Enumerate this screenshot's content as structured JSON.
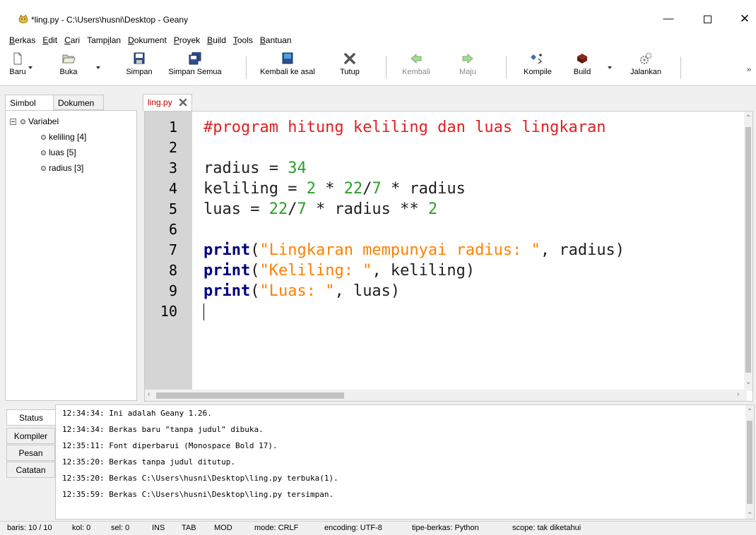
{
  "window": {
    "title": "*ling.py - C:\\Users\\husni\\Desktop - Geany",
    "min_glyph": "—",
    "close_glyph": "✕"
  },
  "menubar": {
    "items": [
      {
        "label": "Berkas",
        "mnemonic_index": 0
      },
      {
        "label": "Edit",
        "mnemonic_index": 0
      },
      {
        "label": "Cari",
        "mnemonic_index": 0
      },
      {
        "label": "Tampilan",
        "mnemonic_index": 4
      },
      {
        "label": "Dokument",
        "mnemonic_index": 0
      },
      {
        "label": "Proyek",
        "mnemonic_index": 0
      },
      {
        "label": "Build",
        "mnemonic_index": 0
      },
      {
        "label": "Tools",
        "mnemonic_index": 0
      },
      {
        "label": "Bantuan",
        "mnemonic_index": 0
      }
    ]
  },
  "toolbar": {
    "baru": "Baru",
    "buka": "Buka",
    "simpan": "Simpan",
    "simpan_semua": "Simpan Semua",
    "kembali_ke_asal": "Kembali ke asal",
    "tutup": "Tutup",
    "kembali": "Kembali",
    "maju": "Maju",
    "kompile": "Kompile",
    "build": "Build",
    "jalankan": "Jalankan",
    "more": "»"
  },
  "sidebar": {
    "tabs": [
      "Simbol",
      "Dokumen"
    ],
    "tree": {
      "root": "Variabel",
      "children": [
        "keliling [4]",
        "luas [5]",
        "radius [3]"
      ]
    }
  },
  "editor": {
    "tab_label": "ling.py",
    "line_numbers": [
      "1",
      "2",
      "3",
      "4",
      "5",
      "6",
      "7",
      "8",
      "9",
      "10"
    ],
    "current_line": 10,
    "lines": [
      [
        {
          "t": "#program hitung keliling dan luas lingkaran",
          "c": "comment"
        }
      ],
      [],
      [
        {
          "t": "radius = ",
          "c": "id"
        },
        {
          "t": "34",
          "c": "num"
        }
      ],
      [
        {
          "t": "keliling = ",
          "c": "id"
        },
        {
          "t": "2",
          "c": "num"
        },
        {
          "t": " * ",
          "c": "id"
        },
        {
          "t": "22",
          "c": "num"
        },
        {
          "t": "/",
          "c": "id"
        },
        {
          "t": "7",
          "c": "num"
        },
        {
          "t": " * radius",
          "c": "id"
        }
      ],
      [
        {
          "t": "luas = ",
          "c": "id"
        },
        {
          "t": "22",
          "c": "num"
        },
        {
          "t": "/",
          "c": "id"
        },
        {
          "t": "7",
          "c": "num"
        },
        {
          "t": " * radius ** ",
          "c": "id"
        },
        {
          "t": "2",
          "c": "num"
        }
      ],
      [],
      [
        {
          "t": "print",
          "c": "kw"
        },
        {
          "t": "(",
          "c": "id"
        },
        {
          "t": "\"Lingkaran mempunyai radius: \"",
          "c": "str"
        },
        {
          "t": ", radius)",
          "c": "id"
        }
      ],
      [
        {
          "t": "print",
          "c": "kw"
        },
        {
          "t": "(",
          "c": "id"
        },
        {
          "t": "\"Keliling: \"",
          "c": "str"
        },
        {
          "t": ", keliling)",
          "c": "id"
        }
      ],
      [
        {
          "t": "print",
          "c": "kw"
        },
        {
          "t": "(",
          "c": "id"
        },
        {
          "t": "\"Luas: \"",
          "c": "str"
        },
        {
          "t": ", luas)",
          "c": "id"
        }
      ],
      []
    ]
  },
  "messages": {
    "tabs": [
      "Status",
      "Kompiler",
      "Pesan",
      "Catatan"
    ],
    "lines": [
      "12:34:34: Ini adalah Geany 1.26.",
      "12:34:34: Berkas baru \"tanpa judul\" dibuka.",
      "12:35:11: Font diperbarui (Monospace Bold 17).",
      "12:35:20: Berkas tanpa judul ditutup.",
      "12:35:20: Berkas C:\\Users\\husni\\Desktop\\ling.py terbuka(1).",
      "12:35:59: Berkas C:\\Users\\husni\\Desktop\\ling.py tersimpan."
    ]
  },
  "statusbar": {
    "line": "baris: 10 / 10",
    "col": "kol: 0",
    "sel": "sel: 0",
    "ins": "INS",
    "tab": "TAB",
    "mod": "MOD",
    "mode": "mode: CRLF",
    "encoding": "encoding: UTF-8",
    "filetype": "tipe-berkas: Python",
    "scope": "scope: tak diketahui"
  },
  "colors": {
    "comment": "#e02020",
    "number": "#2aa02a",
    "keyword": "#00007f",
    "string": "#ff8000",
    "tab_modified": "#c00000"
  }
}
